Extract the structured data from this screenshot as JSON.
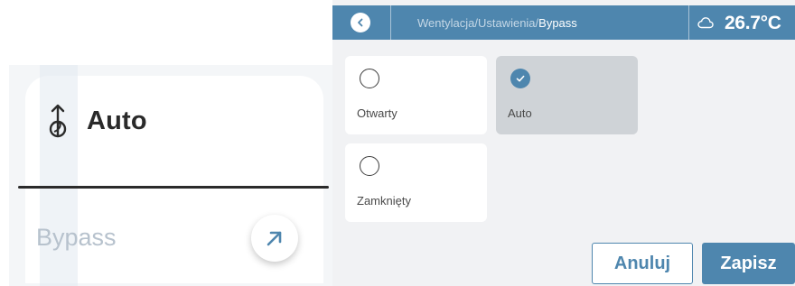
{
  "zoom": {
    "mode_label": "Auto",
    "bypass_label": "Bypass"
  },
  "header": {
    "breadcrumb_path": "Wentylacja/Ustawienia/",
    "breadcrumb_current": "Bypass",
    "temperature": "26.7°C",
    "weather_icon": "cloud-icon",
    "back_icon": "chevron-left-icon"
  },
  "options": [
    {
      "label": "Otwarty",
      "selected": false
    },
    {
      "label": "Auto",
      "selected": true
    },
    {
      "label": "Zamknięty",
      "selected": false
    }
  ],
  "actions": {
    "cancel_label": "Anuluj",
    "save_label": "Zapisz"
  },
  "colors": {
    "accent": "#4e86ae",
    "selected_card": "#cfd3d7",
    "background": "#f1f2f4"
  }
}
